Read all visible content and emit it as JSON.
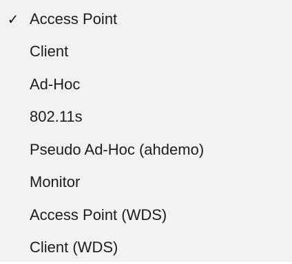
{
  "menu": {
    "check_glyph": "✓",
    "selected_index": 0,
    "items": [
      {
        "label": "Access Point",
        "checked": true
      },
      {
        "label": "Client",
        "checked": false
      },
      {
        "label": "Ad-Hoc",
        "checked": false
      },
      {
        "label": "802.11s",
        "checked": false
      },
      {
        "label": "Pseudo Ad-Hoc (ahdemo)",
        "checked": false
      },
      {
        "label": "Monitor",
        "checked": false
      },
      {
        "label": "Access Point (WDS)",
        "checked": false
      },
      {
        "label": "Client (WDS)",
        "checked": false
      }
    ]
  },
  "colors": {
    "menu_background": "#f2f2f2",
    "text": "#1c1c1c"
  }
}
